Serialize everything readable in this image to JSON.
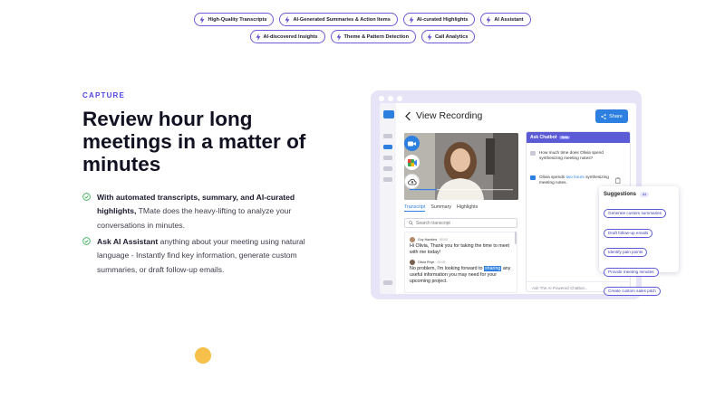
{
  "features": {
    "row1": [
      "High-Quality Transcripts",
      "AI-Generated Summaries & Action Items",
      "AI-curated Highlights",
      "AI Assistant"
    ],
    "row2": [
      "AI-discovered Insights",
      "Theme & Pattern Detection",
      "Call Analytics"
    ]
  },
  "section": {
    "eyebrow": "CAPTURE",
    "headline": "Review hour long meetings in a matter of minutes",
    "bullet1": {
      "bold": "With automated transcripts, summary, and AI-curated highlights,",
      "rest": " TMate does the heavy-lifting to analyze your conversations in minutes."
    },
    "bullet2": {
      "bold": "Ask AI Assistant",
      "rest": " anything about your meeting using natural language - Instantly find key information, generate custom summaries, or draft follow-up emails."
    }
  },
  "app": {
    "title": "View Recording",
    "share_label": "Share",
    "tabs": [
      "Transcript",
      "Summary",
      "Highlights"
    ],
    "search_placeholder": "Search transcript",
    "transcript": [
      {
        "speaker": "Guy Hawkins",
        "time": "00:00",
        "text": "Hi Olivia, Thank you for taking the time to meet with me today!"
      },
      {
        "speaker": "Olivia Rhye",
        "time": "00:05",
        "text_before": "No problem, I'm looking forward to ",
        "highlight": "sharing",
        "text_after": " any useful information you may need for your upcoming project."
      }
    ],
    "chatbot": {
      "title": "Ask Chatbot",
      "badge": "Beta",
      "question": "How much time does Olivia spend synthesizing meeting notes?",
      "answer_prefix": "Olivia spends ",
      "answer_link": "two hours",
      "answer_suffix": " synthesizing meeting notes.",
      "input_placeholder": "Ask The AI Powered Chatbot..."
    },
    "suggestions": {
      "title": "Suggestions",
      "badge": "AI",
      "items": [
        "Generate custom summaries",
        "Draft follow-up emails",
        "Identify pain points",
        "Provide meeting minutes",
        "Create custom sales pitch"
      ]
    }
  },
  "colors": {
    "accent": "#4f46e5",
    "brand_blue": "#2d7fe0",
    "pill_border": "#6b5bd6",
    "dot": "#f6c04a"
  }
}
